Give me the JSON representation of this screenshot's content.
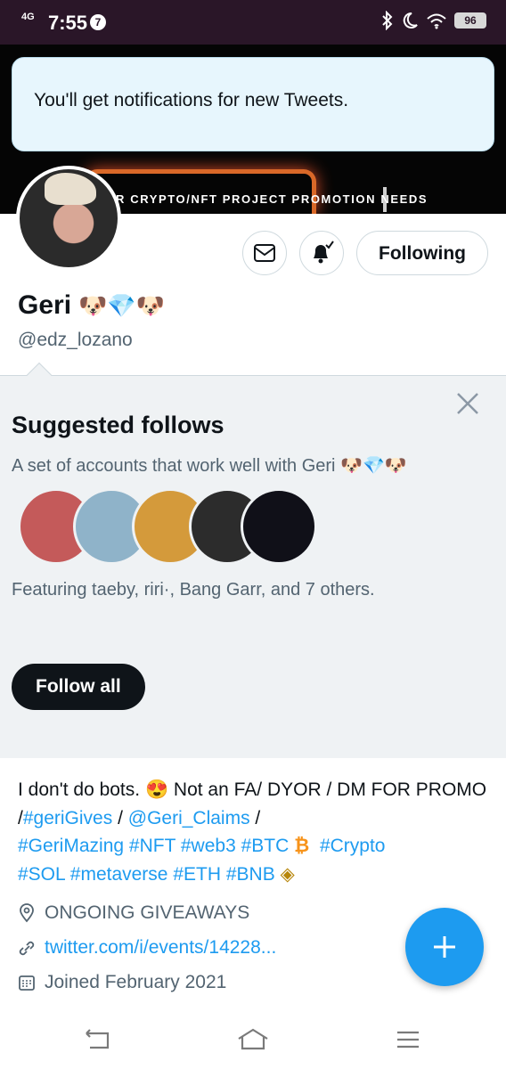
{
  "status_bar": {
    "network": "4G",
    "time": "7:55",
    "notification_count": "7",
    "battery": "96",
    "icons": [
      "bluetooth-icon",
      "moon-icon",
      "wifi-icon",
      "battery-icon"
    ]
  },
  "banner": {
    "tagline": "R  CRYPTO/NFT PROJECT PROMOTION NEEDS"
  },
  "toast": {
    "message": "You'll get notifications for new Tweets."
  },
  "profile": {
    "name": "Geri",
    "name_emojis": "🐶💎🐶",
    "handle": "@edz_lozano",
    "following_label": "Following"
  },
  "suggested": {
    "title": "Suggested follows",
    "subtitle": "A set of accounts that work well with Geri 🐶💎🐶",
    "featuring": "Featuring taeby, riri·, Bang Garr, and 7 others.",
    "follow_all_label": "Follow all",
    "faces": [
      {
        "color": "#c45a5a"
      },
      {
        "color": "#8fb3c9"
      },
      {
        "color": "#d49a3b"
      },
      {
        "color": "#2c2c2c"
      },
      {
        "color": "#101018"
      }
    ]
  },
  "bio": {
    "text1": "I don't do bots. 😍 Not an FA/ DYOR / DM FOR PROMO /",
    "tag_gerigives": "#geriGives",
    "sep1": " / ",
    "mention": "@Geri_Claims",
    "sep2": " / ",
    "tag_gerimazing": "#GeriMazing",
    "tag_nft": "#NFT",
    "tag_web3": "#web3",
    "tag_btc": "#BTC",
    "btc_emoji": "₿",
    "tag_crypto": "#Crypto",
    "tag_sol": "#SOL",
    "tag_metaverse": "#metaverse",
    "tag_eth": "#ETH",
    "tag_bnb": "#BNB",
    "bnb_emoji": "◈"
  },
  "meta": {
    "location": "ONGOING GIVEAWAYS",
    "link": "twitter.com/i/events/14228...",
    "joined": "Joined February 2021"
  },
  "colors": {
    "accent": "#1d9bf0",
    "status_bar": "#2a1628",
    "suggest_bg": "#eff2f4"
  }
}
